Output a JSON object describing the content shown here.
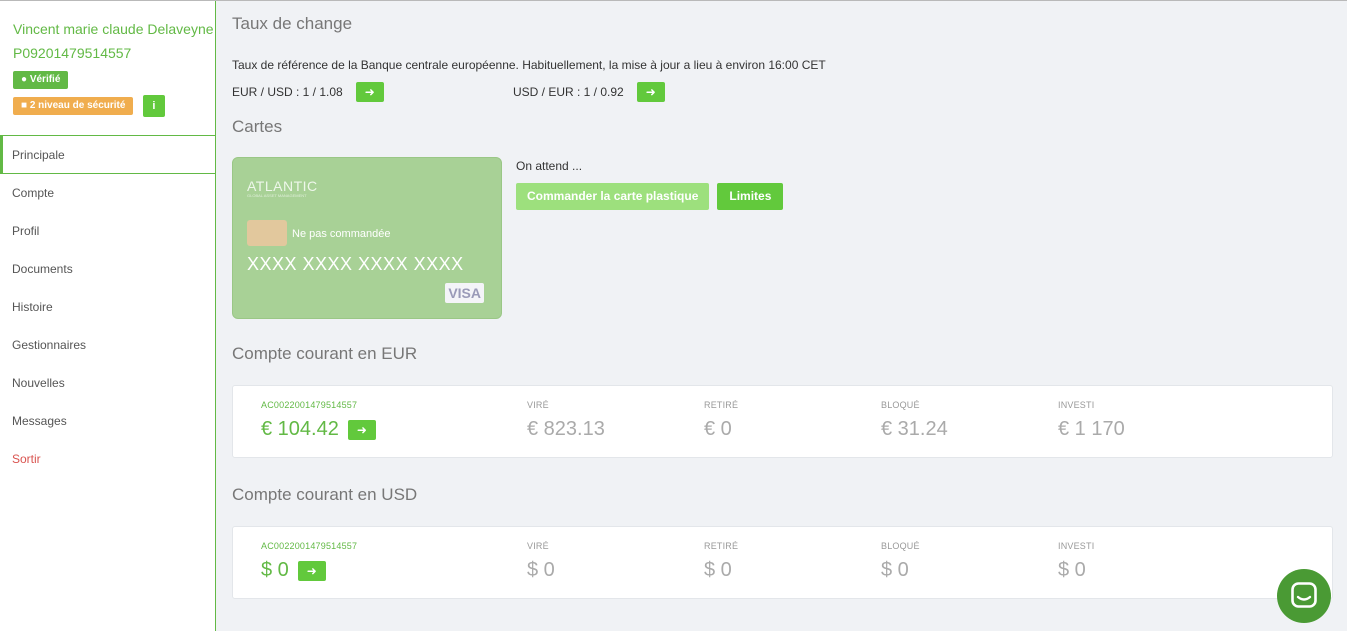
{
  "user": {
    "name": "Vincent marie claude Delaveyne",
    "id": "P09201479514557",
    "verified_label": "Vérifié",
    "security_label": "2 niveau de sécurité",
    "info_glyph": "i"
  },
  "nav": {
    "items": [
      {
        "label": "Principale",
        "active": true
      },
      {
        "label": "Compte"
      },
      {
        "label": "Profil"
      },
      {
        "label": "Documents"
      },
      {
        "label": "Histoire"
      },
      {
        "label": "Gestionnaires"
      },
      {
        "label": "Nouvelles"
      },
      {
        "label": "Messages"
      },
      {
        "label": "Sortir"
      }
    ]
  },
  "rates": {
    "title": "Taux de change",
    "note": "Taux de référence de la Banque centrale européenne. Habituellement, la mise à jour a lieu à environ 16:00 CET",
    "eur_usd": "EUR / USD : 1 / 1.08",
    "usd_eur": "USD / EUR : 1 / 0.92"
  },
  "cards": {
    "title": "Cartes",
    "brand": "ATLANTIC",
    "brand_sub": "GLOBAL ASSET MANAGEMENT",
    "status": "Ne pas commandée",
    "number": "XXXX XXXX XXXX XXXX",
    "network": "VISA",
    "waiting": "On attend ...",
    "order_button": "Commander la carte plastique",
    "limits_button": "Limites"
  },
  "eur_account": {
    "title": "Compte courant en EUR",
    "number": "AC0022001479514557",
    "balance": "€ 104.42",
    "transferred_label": "VIRÉ",
    "transferred": "€ 823.13",
    "withdrawn_label": "RETIRÉ",
    "withdrawn": "€ 0",
    "blocked_label": "BLOQUÉ",
    "blocked": "€ 31.24",
    "invested_label": "INVESTI",
    "invested": "€ 1 170"
  },
  "usd_account": {
    "title": "Compte courant en USD",
    "number": "AC0022001479514557",
    "balance": "$ 0",
    "transferred_label": "VIRÉ",
    "transferred": "$ 0",
    "withdrawn_label": "RETIRÉ",
    "withdrawn": "$ 0",
    "blocked_label": "BLOQUÉ",
    "blocked": "$ 0",
    "invested_label": "INVESTI",
    "invested": "$ 0"
  },
  "colors": {
    "accent": "#62b945",
    "button": "#62c93c",
    "warning": "#f0ad4e",
    "danger": "#d9534f"
  }
}
